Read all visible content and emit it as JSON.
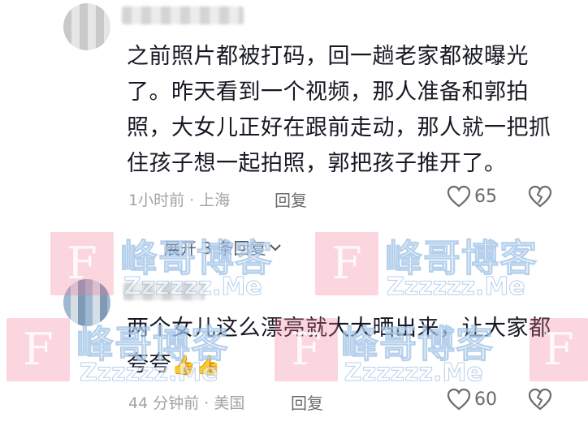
{
  "comments": [
    {
      "text": "之前照片都被打码，回一趟老家都被曝光了。昨天看到一个视频，那人准备和郭拍照，大女儿正好在跟前走动，那人就一把抓住孩子想一起拍照，郭把孩子推开了。",
      "meta": "1小时前 · 上海",
      "reply_label": "回复",
      "likes": "65",
      "like_icon": "heart-outline-icon",
      "dislike_icon": "broken-heart-icon"
    },
    {
      "text": "两个女儿这么漂亮就大大晒出来，让大家都夸夸",
      "emoji": "👍👍",
      "meta": "44 分钟前 · 美国",
      "reply_label": "回复",
      "likes": "60",
      "like_icon": "heart-outline-icon",
      "dislike_icon": "broken-heart-icon"
    }
  ],
  "expand_replies": {
    "label": "展开 3 条回复",
    "icon": "chevron-down-icon"
  },
  "watermark": {
    "logo_letter": "F",
    "brand_cn": "峰哥博客",
    "brand_en": "Zzzzzz.Me",
    "tile_color": "#f27896"
  },
  "colors": {
    "text_primary": "#161823",
    "text_secondary": "#a3a3a8",
    "action_gray": "#6b6b70"
  }
}
